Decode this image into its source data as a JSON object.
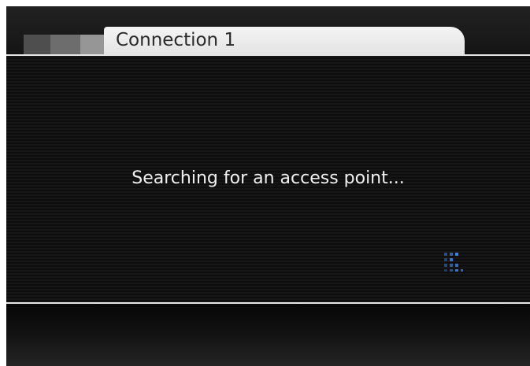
{
  "tabs": {
    "active_title": "Connection 1"
  },
  "status": {
    "message": "Searching for an access point..."
  },
  "indicator": {
    "icon": "loading-dots-icon",
    "color": "#3f7fd6"
  }
}
